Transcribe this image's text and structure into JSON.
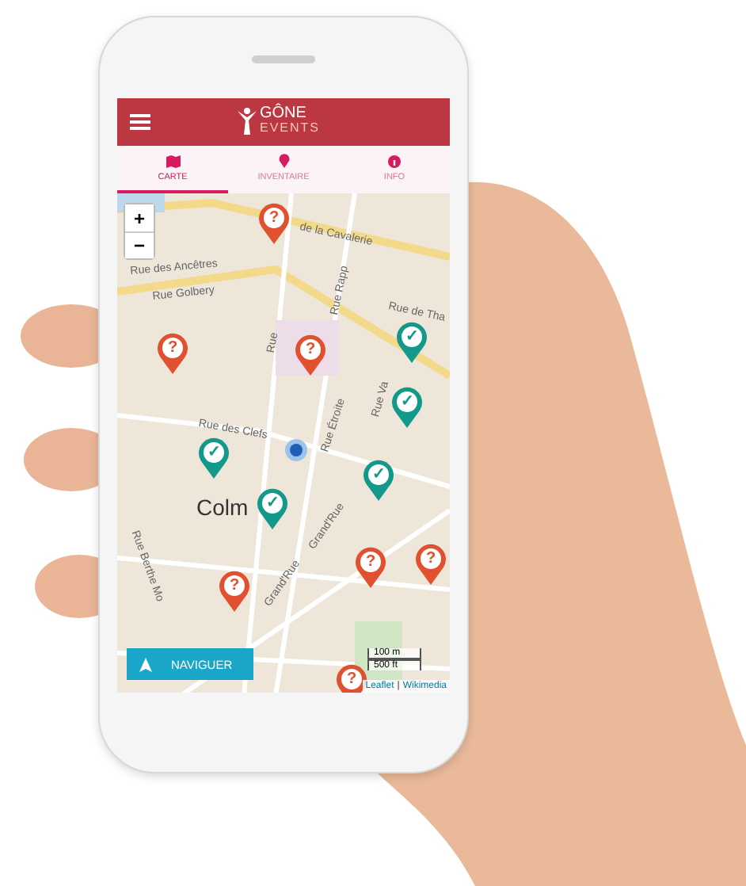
{
  "app_bar": {
    "logo_top": "GÔNE",
    "logo_bottom": "EVENTS"
  },
  "tabs": [
    {
      "label": "CARTE",
      "selected": true
    },
    {
      "label": "INVENTAIRE",
      "selected": false
    },
    {
      "label": "INFO",
      "selected": false
    }
  ],
  "map": {
    "zoom_in": "+",
    "zoom_out": "−",
    "street_labels": [
      "de la Cavalerie",
      "Rue des Ancêtres",
      "Rue Golbery",
      "Rue Rapp",
      "Rue de Tha",
      "Rue",
      "Rue Étroite",
      "Rue des Clefs",
      "Rue Va",
      "Colm",
      "Grand'Rue",
      "Grand'Rue",
      "Rue Berthe Mo"
    ],
    "markers": [
      {
        "kind": "unknown",
        "symbol": "?"
      },
      {
        "kind": "unknown",
        "symbol": "?"
      },
      {
        "kind": "unknown",
        "symbol": "?"
      },
      {
        "kind": "visited",
        "symbol": "✓"
      },
      {
        "kind": "visited",
        "symbol": "✓"
      },
      {
        "kind": "visited",
        "symbol": "✓"
      },
      {
        "kind": "visited",
        "symbol": "✓"
      },
      {
        "kind": "visited",
        "symbol": "✓"
      },
      {
        "kind": "unknown",
        "symbol": "?"
      },
      {
        "kind": "unknown",
        "symbol": "?"
      },
      {
        "kind": "unknown",
        "symbol": "?"
      },
      {
        "kind": "unknown",
        "symbol": "?"
      }
    ],
    "navigate_button": "NAVIGUER",
    "scale": [
      "100 m",
      "500 ft"
    ],
    "attribution": [
      "Leaflet",
      "|",
      "Wikimedia"
    ]
  }
}
